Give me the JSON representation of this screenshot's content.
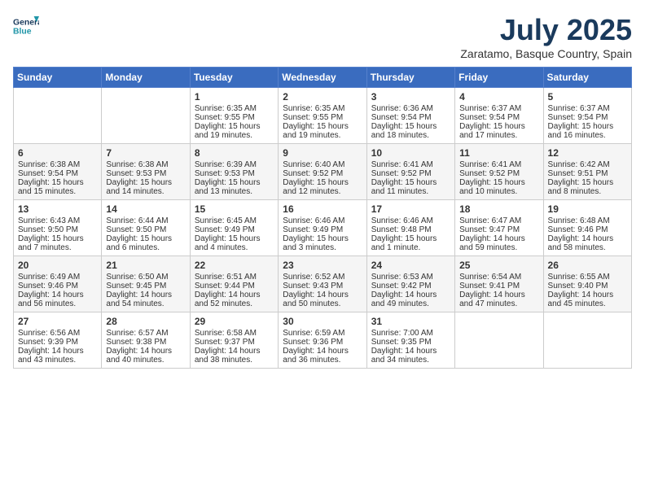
{
  "header": {
    "logo_line1": "General",
    "logo_line2": "Blue",
    "month": "July 2025",
    "location": "Zaratamo, Basque Country, Spain"
  },
  "weekdays": [
    "Sunday",
    "Monday",
    "Tuesday",
    "Wednesday",
    "Thursday",
    "Friday",
    "Saturday"
  ],
  "weeks": [
    [
      {
        "day": null,
        "content": null
      },
      {
        "day": null,
        "content": null
      },
      {
        "day": "1",
        "content": "Sunrise: 6:35 AM\nSunset: 9:55 PM\nDaylight: 15 hours\nand 19 minutes."
      },
      {
        "day": "2",
        "content": "Sunrise: 6:35 AM\nSunset: 9:55 PM\nDaylight: 15 hours\nand 19 minutes."
      },
      {
        "day": "3",
        "content": "Sunrise: 6:36 AM\nSunset: 9:54 PM\nDaylight: 15 hours\nand 18 minutes."
      },
      {
        "day": "4",
        "content": "Sunrise: 6:37 AM\nSunset: 9:54 PM\nDaylight: 15 hours\nand 17 minutes."
      },
      {
        "day": "5",
        "content": "Sunrise: 6:37 AM\nSunset: 9:54 PM\nDaylight: 15 hours\nand 16 minutes."
      }
    ],
    [
      {
        "day": "6",
        "content": "Sunrise: 6:38 AM\nSunset: 9:54 PM\nDaylight: 15 hours\nand 15 minutes."
      },
      {
        "day": "7",
        "content": "Sunrise: 6:38 AM\nSunset: 9:53 PM\nDaylight: 15 hours\nand 14 minutes."
      },
      {
        "day": "8",
        "content": "Sunrise: 6:39 AM\nSunset: 9:53 PM\nDaylight: 15 hours\nand 13 minutes."
      },
      {
        "day": "9",
        "content": "Sunrise: 6:40 AM\nSunset: 9:52 PM\nDaylight: 15 hours\nand 12 minutes."
      },
      {
        "day": "10",
        "content": "Sunrise: 6:41 AM\nSunset: 9:52 PM\nDaylight: 15 hours\nand 11 minutes."
      },
      {
        "day": "11",
        "content": "Sunrise: 6:41 AM\nSunset: 9:52 PM\nDaylight: 15 hours\nand 10 minutes."
      },
      {
        "day": "12",
        "content": "Sunrise: 6:42 AM\nSunset: 9:51 PM\nDaylight: 15 hours\nand 8 minutes."
      }
    ],
    [
      {
        "day": "13",
        "content": "Sunrise: 6:43 AM\nSunset: 9:50 PM\nDaylight: 15 hours\nand 7 minutes."
      },
      {
        "day": "14",
        "content": "Sunrise: 6:44 AM\nSunset: 9:50 PM\nDaylight: 15 hours\nand 6 minutes."
      },
      {
        "day": "15",
        "content": "Sunrise: 6:45 AM\nSunset: 9:49 PM\nDaylight: 15 hours\nand 4 minutes."
      },
      {
        "day": "16",
        "content": "Sunrise: 6:46 AM\nSunset: 9:49 PM\nDaylight: 15 hours\nand 3 minutes."
      },
      {
        "day": "17",
        "content": "Sunrise: 6:46 AM\nSunset: 9:48 PM\nDaylight: 15 hours\nand 1 minute."
      },
      {
        "day": "18",
        "content": "Sunrise: 6:47 AM\nSunset: 9:47 PM\nDaylight: 14 hours\nand 59 minutes."
      },
      {
        "day": "19",
        "content": "Sunrise: 6:48 AM\nSunset: 9:46 PM\nDaylight: 14 hours\nand 58 minutes."
      }
    ],
    [
      {
        "day": "20",
        "content": "Sunrise: 6:49 AM\nSunset: 9:46 PM\nDaylight: 14 hours\nand 56 minutes."
      },
      {
        "day": "21",
        "content": "Sunrise: 6:50 AM\nSunset: 9:45 PM\nDaylight: 14 hours\nand 54 minutes."
      },
      {
        "day": "22",
        "content": "Sunrise: 6:51 AM\nSunset: 9:44 PM\nDaylight: 14 hours\nand 52 minutes."
      },
      {
        "day": "23",
        "content": "Sunrise: 6:52 AM\nSunset: 9:43 PM\nDaylight: 14 hours\nand 50 minutes."
      },
      {
        "day": "24",
        "content": "Sunrise: 6:53 AM\nSunset: 9:42 PM\nDaylight: 14 hours\nand 49 minutes."
      },
      {
        "day": "25",
        "content": "Sunrise: 6:54 AM\nSunset: 9:41 PM\nDaylight: 14 hours\nand 47 minutes."
      },
      {
        "day": "26",
        "content": "Sunrise: 6:55 AM\nSunset: 9:40 PM\nDaylight: 14 hours\nand 45 minutes."
      }
    ],
    [
      {
        "day": "27",
        "content": "Sunrise: 6:56 AM\nSunset: 9:39 PM\nDaylight: 14 hours\nand 43 minutes."
      },
      {
        "day": "28",
        "content": "Sunrise: 6:57 AM\nSunset: 9:38 PM\nDaylight: 14 hours\nand 40 minutes."
      },
      {
        "day": "29",
        "content": "Sunrise: 6:58 AM\nSunset: 9:37 PM\nDaylight: 14 hours\nand 38 minutes."
      },
      {
        "day": "30",
        "content": "Sunrise: 6:59 AM\nSunset: 9:36 PM\nDaylight: 14 hours\nand 36 minutes."
      },
      {
        "day": "31",
        "content": "Sunrise: 7:00 AM\nSunset: 9:35 PM\nDaylight: 14 hours\nand 34 minutes."
      },
      {
        "day": null,
        "content": null
      },
      {
        "day": null,
        "content": null
      }
    ]
  ]
}
